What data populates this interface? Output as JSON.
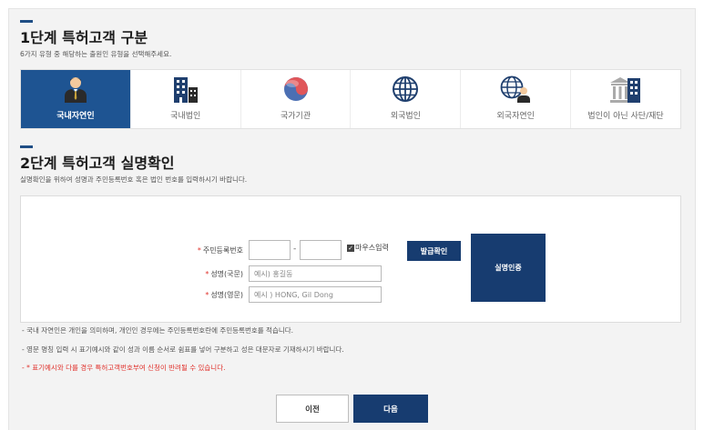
{
  "step1": {
    "title": "1단계 특허고객 구분",
    "desc": "6가지 유형 중 해당하는 출원인 유형을 선택해주세요."
  },
  "types": [
    {
      "label": "국내자연인",
      "icon": "person-icon",
      "active": true
    },
    {
      "label": "국내법인",
      "icon": "building-icon",
      "active": false
    },
    {
      "label": "국가기관",
      "icon": "taegeuk-icon",
      "active": false
    },
    {
      "label": "외국법인",
      "icon": "globe-icon",
      "active": false
    },
    {
      "label": "외국자연인",
      "icon": "globe-person-icon",
      "active": false
    },
    {
      "label": "법인이 아닌 사단/재단",
      "icon": "institution-icon",
      "active": false
    }
  ],
  "step2": {
    "title": "2단계 특허고객 실명확인",
    "desc": "실명확인을 위하여 성명과 주민등록번호 혹은 법인 번호를 입력하시기 바랍니다."
  },
  "form": {
    "required_mark": "*",
    "rrn_label": "주민등록번호",
    "rrn_front_value": "",
    "rrn_back_value": "",
    "rrn_dash": "-",
    "mouse_input_label": "마우스입력",
    "issue_check_button": "발급확인",
    "name_kr_label": "성명(국문)",
    "name_kr_placeholder": "예시) 홍길동",
    "name_en_label": "성명(영문)",
    "name_en_placeholder": "예시 ) HONG, Gil Dong",
    "verify_button": "실명인증"
  },
  "notes": [
    "- 국내 자연인은 개인을 의미하며, 개인인 경우에는 주민등록번호란에 주민등록번호를 적습니다.",
    "- 영문 명칭 입력 시 표기예시와 같이 성과 이름 순서로 쉼표를 넣어 구분하고 성은 대문자로 기재하시기 바랍니다.",
    "- * 표기예시와 다를 경우 특허고객번호부여 신청이 반려될 수 있습니다."
  ],
  "buttons": {
    "prev": "이전",
    "next": "다음"
  },
  "colors": {
    "accent": "#1e5492",
    "navy": "#173c70",
    "required": "#e0322c"
  }
}
